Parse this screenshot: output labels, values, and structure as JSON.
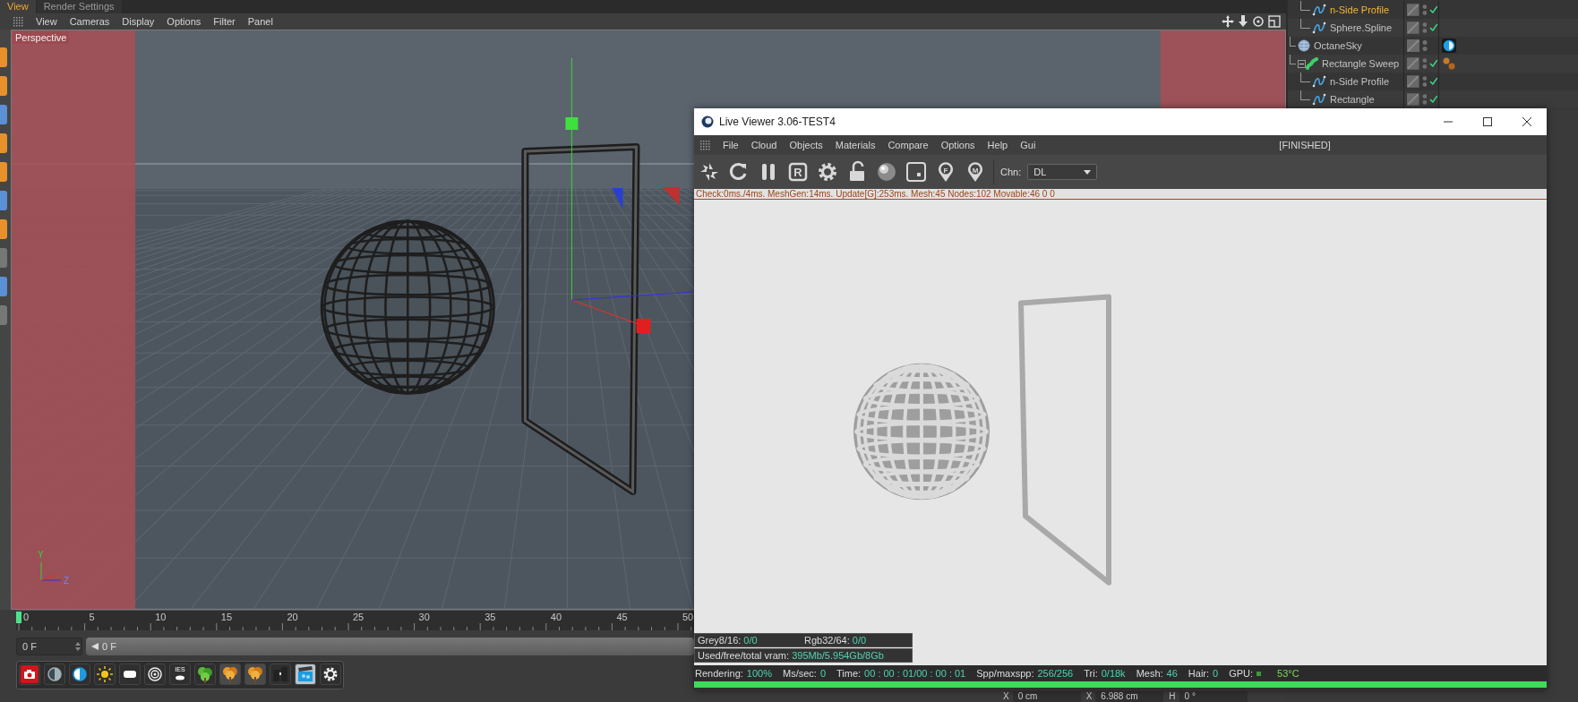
{
  "panel_tabs": [
    {
      "label": "View",
      "selected": true
    },
    {
      "label": "Render Settings",
      "selected": false
    }
  ],
  "viewport": {
    "menu": [
      "View",
      "Cameras",
      "Display",
      "Options",
      "Filter",
      "Panel"
    ],
    "camera_label": "Perspective",
    "axis_labels": [
      "Y",
      "Z"
    ]
  },
  "outliner": {
    "items": [
      {
        "children": [
          {
            "label": "n-Side Profile",
            "kind": "spline",
            "selected": true,
            "checked": true
          },
          {
            "label": "Sphere.Spline",
            "kind": "spline",
            "selected": false,
            "checked": true
          }
        ]
      },
      {
        "label": "OctaneSky",
        "kind": "sky",
        "selected": false,
        "checked": false,
        "tag": {
          "kind": "sky"
        }
      },
      {
        "label": "Rectangle Sweep",
        "kind": "sweep",
        "selected": false,
        "checked": true,
        "expanded": true,
        "tag": {
          "kind": "material"
        },
        "children": [
          {
            "label": "n-Side Profile",
            "kind": "spline",
            "selected": false,
            "checked": true
          },
          {
            "label": "Rectangle",
            "kind": "spline",
            "selected": false,
            "checked": true
          }
        ]
      }
    ]
  },
  "timeline": {
    "ticks": [
      "0",
      "5",
      "10",
      "15",
      "20",
      "25",
      "30",
      "35",
      "40",
      "45",
      "50"
    ]
  },
  "frame_field": {
    "value": "0 F"
  },
  "frame_slider": {
    "value": "0 F",
    "level": 0
  },
  "octane_toolbar": [
    {
      "kind": "camera",
      "selected": false
    },
    {
      "kind": "daylight",
      "selected": false
    },
    {
      "kind": "environment",
      "selected": false
    },
    {
      "kind": "sun",
      "selected": false
    },
    {
      "kind": "area-light",
      "selected": false
    },
    {
      "kind": "target-light",
      "selected": false
    },
    {
      "kind": "ies",
      "text": "IES",
      "selected": false
    },
    {
      "kind": "shrub",
      "selected": false
    },
    {
      "kind": "tree",
      "selected": false
    },
    {
      "kind": "tree",
      "selected": false
    },
    {
      "kind": "gate",
      "selected": false
    },
    {
      "kind": "clapper",
      "selected": true
    },
    {
      "kind": "settings",
      "selected": false
    }
  ],
  "coordinates": [
    {
      "axis": "X",
      "value": "0 cm"
    },
    {
      "axis": "X",
      "value": "6.988 cm"
    },
    {
      "axis": "H",
      "value": "0 °"
    }
  ],
  "live_viewer": {
    "title": "Live Viewer 3.06-TEST4",
    "menu": [
      "File",
      "Cloud",
      "Objects",
      "Materials",
      "Compare",
      "Options",
      "Help",
      "Gui"
    ],
    "status": "[FINISHED]",
    "toolbar": [
      {
        "kind": "aperture"
      },
      {
        "kind": "restart"
      },
      {
        "kind": "pause"
      },
      {
        "kind": "letter",
        "text": "R"
      },
      {
        "kind": "gear"
      },
      {
        "kind": "lock"
      },
      {
        "kind": "ball"
      },
      {
        "kind": "region"
      },
      {
        "kind": "pin",
        "text": "F"
      },
      {
        "kind": "pin",
        "text": "M"
      }
    ],
    "channel": {
      "label": "Chn:",
      "value": "DL"
    },
    "info": "Check:0ms./4ms. MeshGen:14ms. Update[G]:253ms. Mesh:45 Nodes:102 Movable:46  0 0",
    "stats": [
      {
        "label": "Grey8/16:",
        "value": "0/0"
      },
      {
        "label": "Rgb32/64:",
        "value": "0/0"
      }
    ],
    "vram": {
      "label": "Used/free/total vram:",
      "value": "395Mb/5.954Gb/8Gb"
    },
    "status_bar": [
      {
        "kind": "text",
        "label": "Rendering:",
        "value": "100%"
      },
      {
        "kind": "text",
        "label": "Ms/sec:",
        "value": "0"
      },
      {
        "kind": "text",
        "label": "Time:",
        "value": "00 : 00 : 01/00 : 00 : 01"
      },
      {
        "kind": "text",
        "label": "Spp/maxspp:",
        "value": "256/256"
      },
      {
        "kind": "text",
        "label": "Tri:",
        "value": "0/18k"
      },
      {
        "kind": "text",
        "label": "Mesh:",
        "value": "46"
      },
      {
        "kind": "text",
        "label": "Hair:",
        "value": "0"
      },
      {
        "kind": "gpu",
        "label": "GPU:",
        "value": "53°C"
      }
    ],
    "progress": {
      "level": 1
    }
  }
}
